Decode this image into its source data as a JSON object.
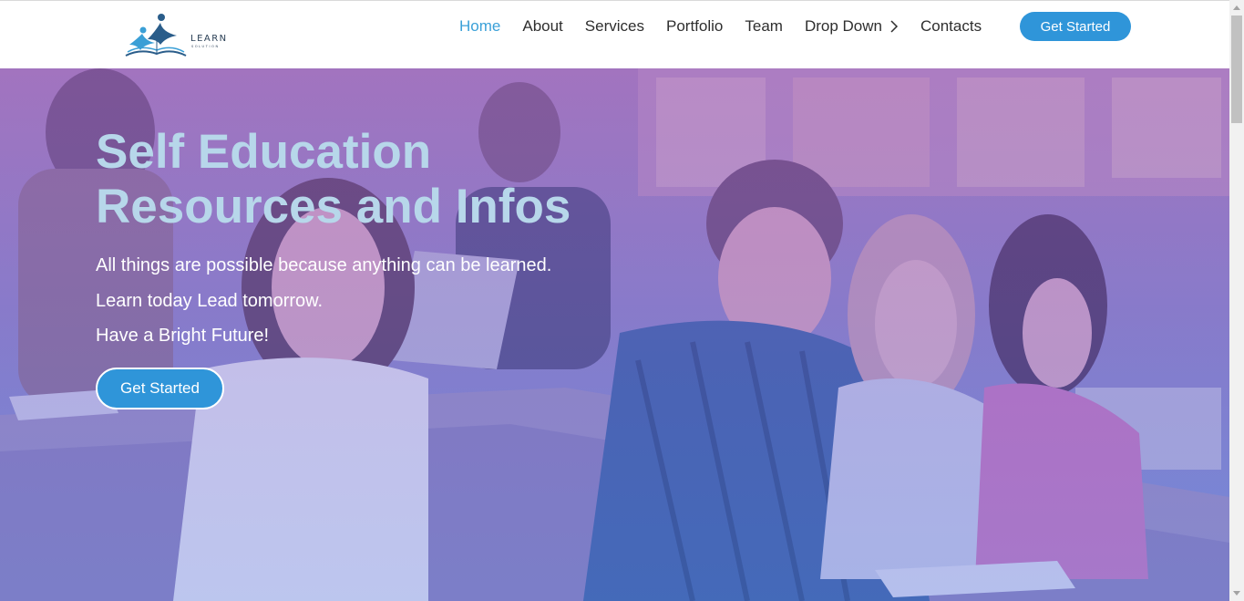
{
  "header": {
    "logo": {
      "icon": "learn-solution-logo-icon",
      "word": "LEARN",
      "sub": "SOLUTION"
    },
    "nav": [
      {
        "label": "Home",
        "active": true
      },
      {
        "label": "About"
      },
      {
        "label": "Services"
      },
      {
        "label": "Portfolio"
      },
      {
        "label": "Team"
      },
      {
        "label": "Drop Down",
        "icon": "chevron-right-icon"
      },
      {
        "label": "Contacts"
      }
    ],
    "cta_label": "Get Started"
  },
  "hero": {
    "title": "Self Education Resources and Infos",
    "lines": [
      "All things are possible because anything can be learned.",
      "Learn today Lead tomorrow.",
      "Have a Bright Future!"
    ],
    "cta_label": "Get Started",
    "background": "classroom-students-photo"
  },
  "colors": {
    "accent": "#2f95d9",
    "active_nav": "#3aa0d8",
    "title": "#b7d7ea",
    "overlay_top": "#a37fbf",
    "overlay_bottom": "#7d8fd6"
  }
}
